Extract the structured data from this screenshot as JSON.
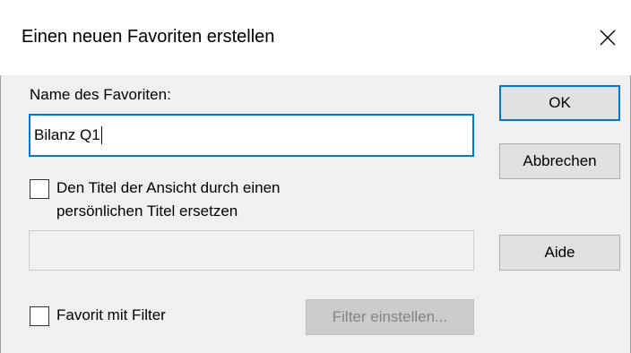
{
  "window": {
    "title": "Einen neuen Favoriten erstellen",
    "close_icon": "close-icon"
  },
  "form": {
    "name_label": "Name des Favoriten:",
    "name_value": "Bilanz Q1",
    "replace_title_label_line1": "Den Titel der Ansicht durch einen",
    "replace_title_label_line2": "persönlichen Titel ersetzen",
    "replace_title_checked": false,
    "custom_title_value": "",
    "filter_label": "Favorit mit Filter",
    "filter_checked": false
  },
  "buttons": {
    "ok": "OK",
    "cancel": "Abbrechen",
    "help": "Aide",
    "set_filter": "Filter einstellen..."
  },
  "colors": {
    "focus_accent": "#0078d7",
    "dialog_background": "#f0f0f0"
  }
}
